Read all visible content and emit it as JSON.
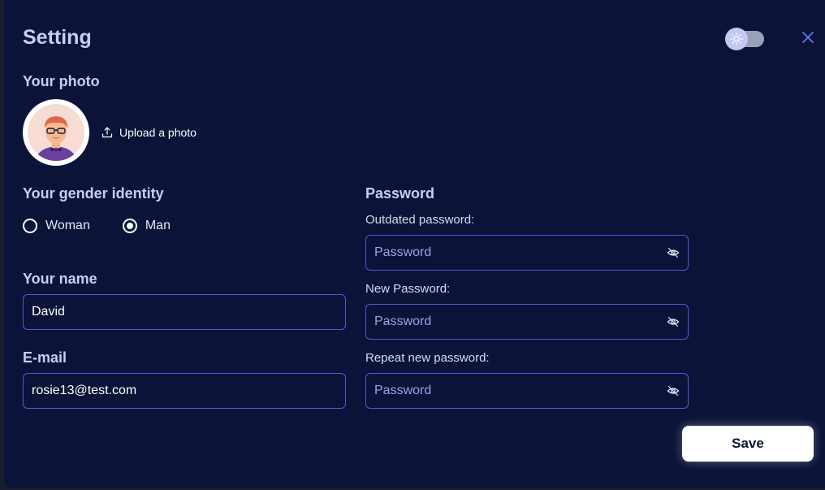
{
  "modal": {
    "title": "Setting"
  },
  "photo": {
    "label": "Your photo",
    "upload_label": "Upload a photo"
  },
  "gender": {
    "label": "Your gender identity",
    "options": [
      {
        "label": "Woman",
        "selected": false
      },
      {
        "label": "Man",
        "selected": true
      }
    ]
  },
  "name": {
    "label": "Your name",
    "value": "David"
  },
  "email": {
    "label": "E-mail",
    "value": "rosie13@test.com"
  },
  "password": {
    "label": "Password",
    "outdated": {
      "label": "Outdated password:",
      "placeholder": "Password"
    },
    "new": {
      "label": "New Password:",
      "placeholder": "Password"
    },
    "repeat": {
      "label": "Repeat new password:",
      "placeholder": "Password"
    }
  },
  "actions": {
    "save_label": "Save"
  },
  "icons": {
    "theme_toggle": "sun-icon",
    "close": "close-icon",
    "upload": "upload-icon",
    "eye": "eye-off-icon"
  },
  "colors": {
    "background": "#0b1338",
    "accent": "#4d5bd8",
    "text": "#c9cdf2",
    "placeholder": "#9aa3e8",
    "close": "#5b7cf5"
  }
}
